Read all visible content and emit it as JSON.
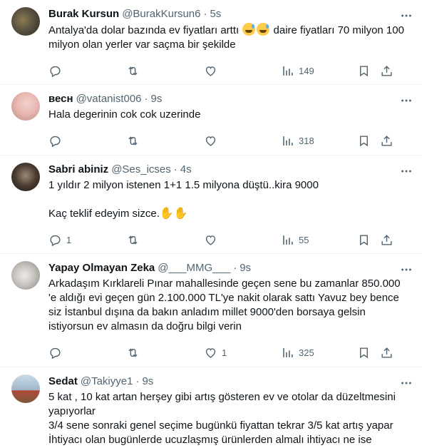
{
  "tweets": [
    {
      "name": "Burak Kursun",
      "handle": "@BurakKursun6",
      "time": "5s",
      "text_before_emoji": "Antalya'da dolar bazında ev fiyatları arttı ",
      "emoji": [
        "sweat-smile-emoji",
        "sweat-smile-emoji"
      ],
      "text_after_emoji": " daire fiyatları 70 milyon 100 milyon olan yerler var saçma bir şekilde",
      "reply_count": "",
      "retweet_count": "",
      "like_count": "",
      "views": "149",
      "avatar_color": "#5b5240"
    },
    {
      "name": "весн",
      "handle": "@vatanist006",
      "time": "9s",
      "lines": [
        "Hala degerinin cok cok uzerinde"
      ],
      "reply_count": "",
      "retweet_count": "",
      "like_count": "",
      "views": "318",
      "avatar_color": "#e9b7b2"
    },
    {
      "name": "Sabri abiniz",
      "handle": "@Ses_icses",
      "time": "4s",
      "line1": "1 yıldır 2 milyon istenen 1+1  1.5 milyona düştü..kira 9000",
      "line2": "Kaç teklif edeyim sizce.",
      "emoji": [
        "raised-hand-emoji",
        "raised-hand-emoji"
      ],
      "reply_count": "1",
      "retweet_count": "",
      "like_count": "",
      "views": "55",
      "avatar_color": "#4a3c30"
    },
    {
      "name": "Yapay Olmayan Zeka",
      "handle": "@___MMG___",
      "time": "9s",
      "lines": [
        "Arkadaşım Kırklareli Pınar mahallesinde geçen sene bu zamanlar 850.000",
        "'e aldığı evi geçen gün 2.100.000 TL'ye nakit olarak sattı Yavuz bey bence",
        "siz İstanbul dışına da bakın anladım millet 9000'den borsaya gelsin",
        "istiyorsun ev almasın da doğru bilgi verin"
      ],
      "reply_count": "",
      "retweet_count": "",
      "like_count": "1",
      "views": "325",
      "avatar_color": "#c8c4c0"
    },
    {
      "name": "Sedat",
      "handle": "@Takiyye1",
      "time": "9s",
      "lines": [
        "5 kat , 10 kat artan herşey gibi artış gösteren ev ve otolar da düzeltmesini",
        "yapıyorlar",
        "3/4 sene sonraki genel seçime bugünkü fiyattan tekrar 3/5 kat artış yapar",
        "İhtiyacı olan bugünlerde ucuzlaşmış ürünlerden almalı ihtiyacı ne ise"
      ],
      "avatar_color": "#9fb6c9"
    }
  ]
}
